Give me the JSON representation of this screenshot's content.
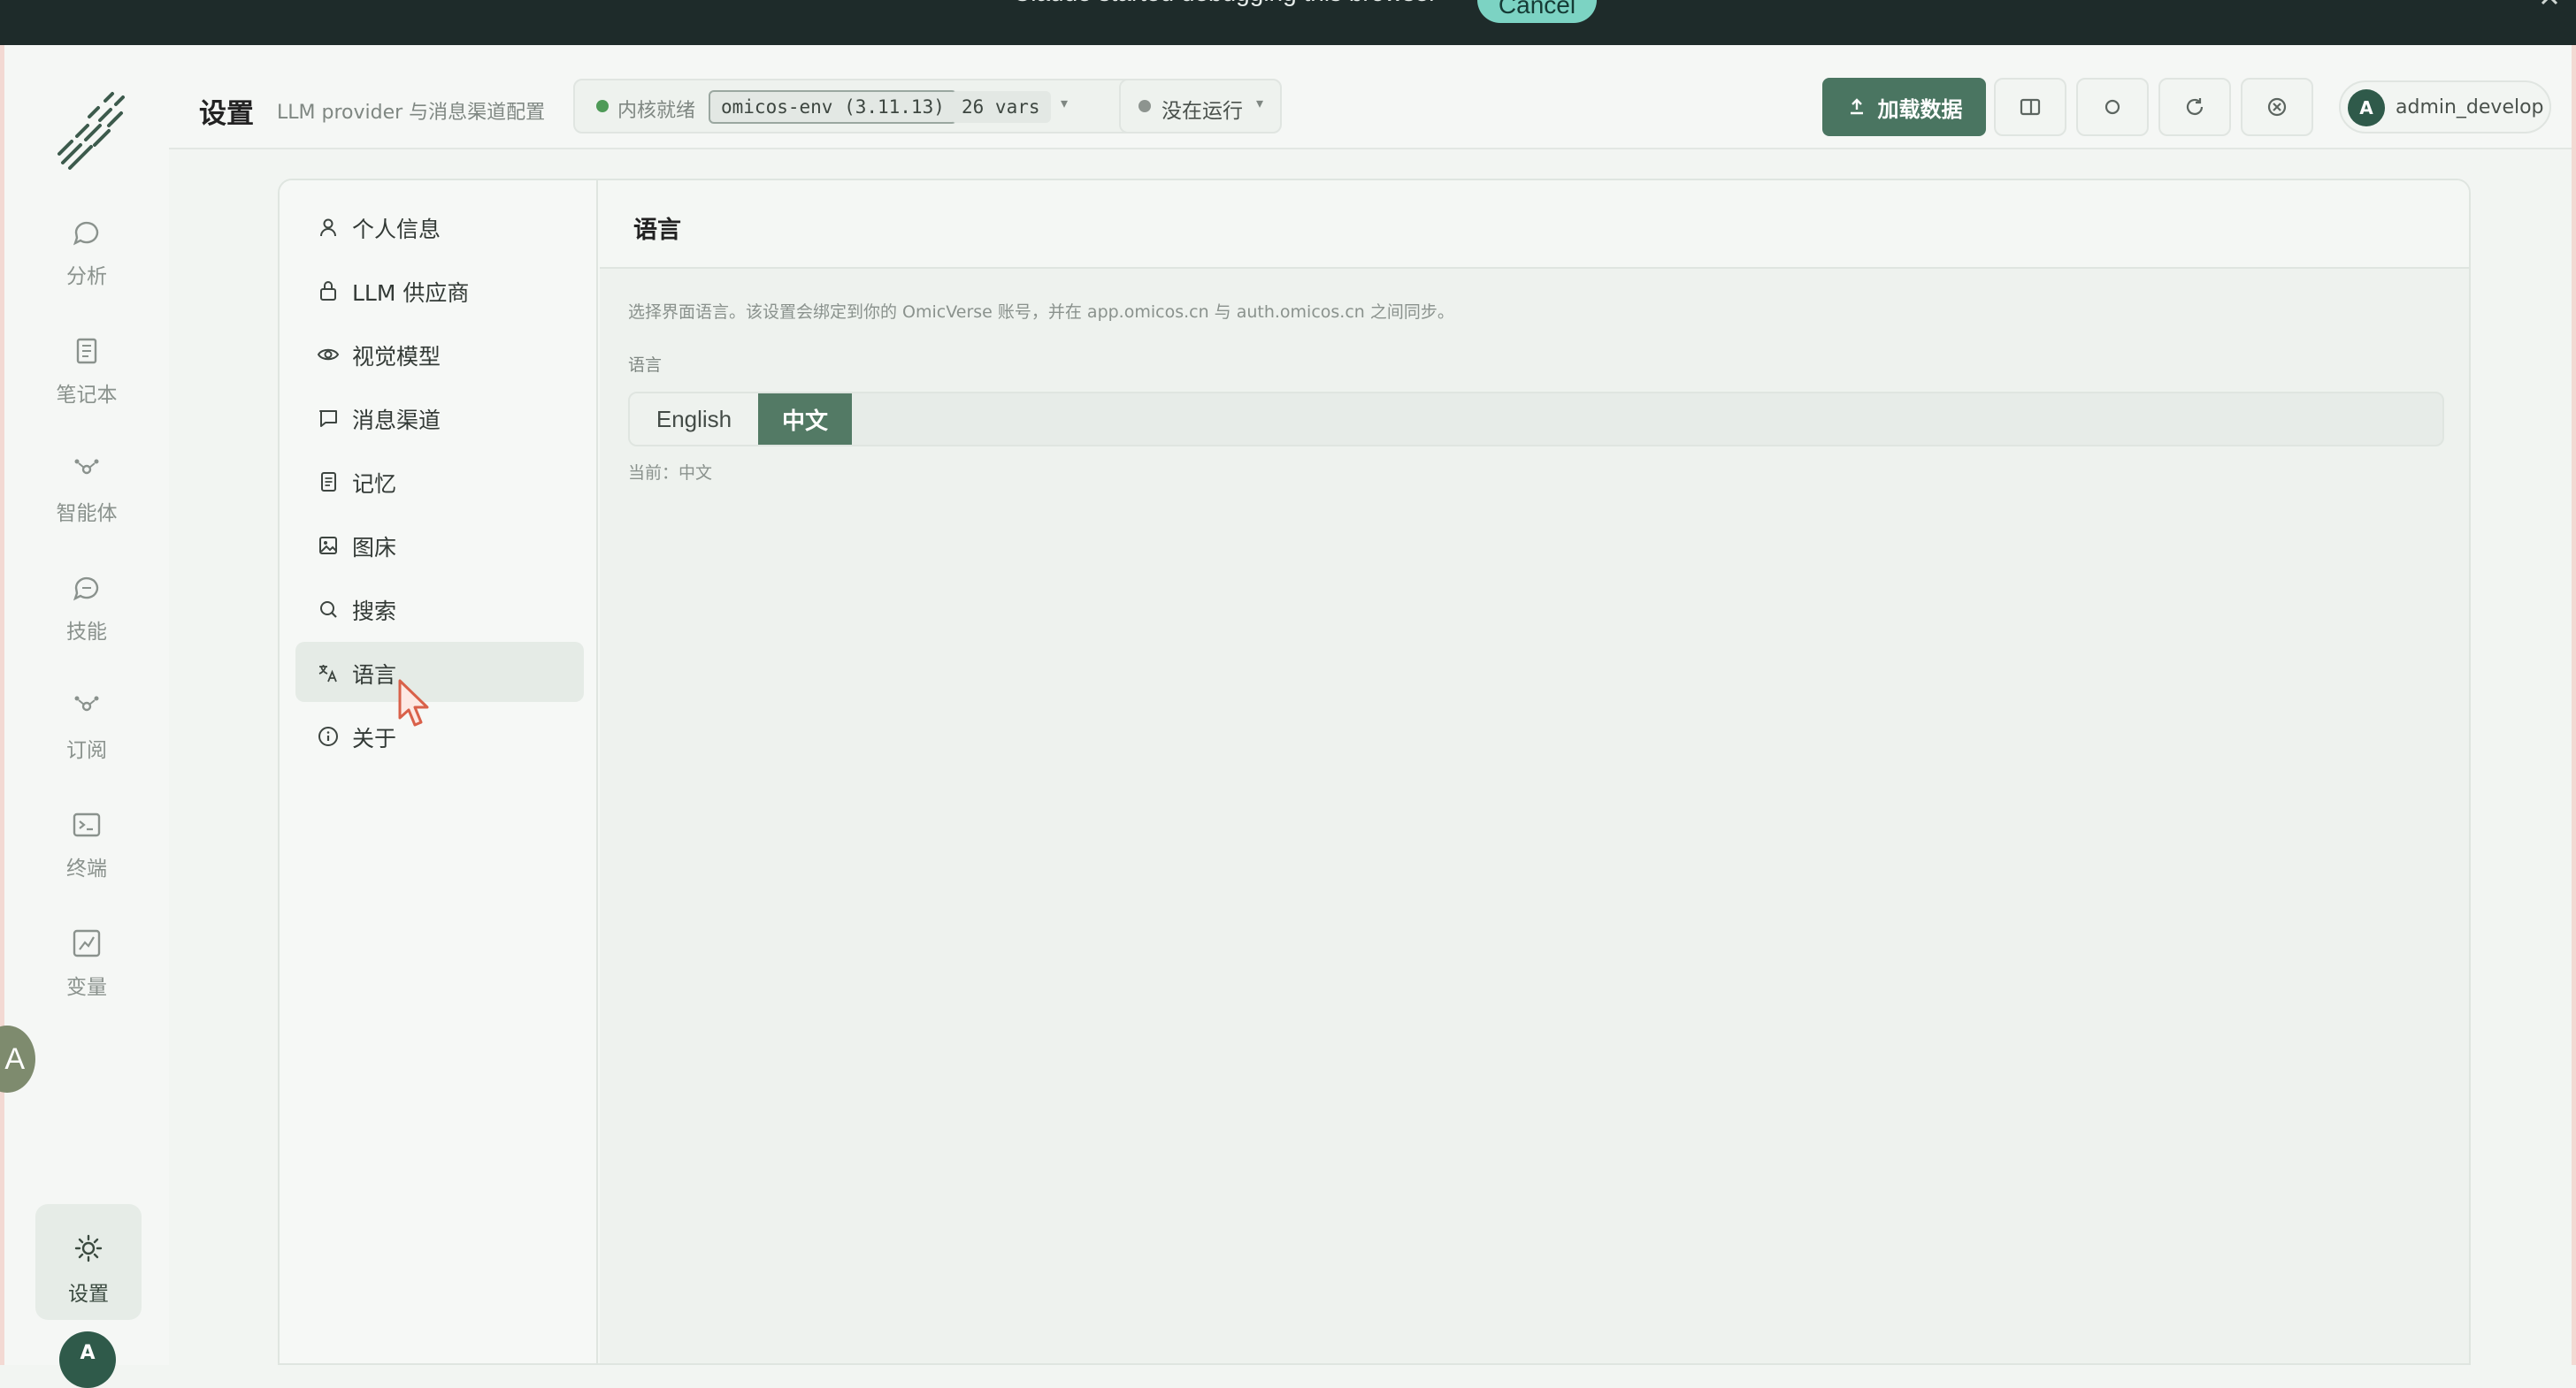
{
  "banner": {
    "text": "Claude  started debugging this browser",
    "cancel_label": "Cancel"
  },
  "rail": {
    "items": [
      {
        "label": "分析",
        "icon": "chat-bubble-icon"
      },
      {
        "label": "笔记本",
        "icon": "notebook-icon"
      },
      {
        "label": "智能体",
        "icon": "agent-nodes-icon"
      },
      {
        "label": "技能",
        "icon": "chat-bubble-icon"
      },
      {
        "label": "订阅",
        "icon": "agent-nodes-icon"
      },
      {
        "label": "终端",
        "icon": "terminal-icon"
      },
      {
        "label": "变量",
        "icon": "variables-icon"
      }
    ],
    "settings_label": "设置",
    "avatar_initial": "A",
    "float_badge_text": "A"
  },
  "header": {
    "title": "设置",
    "subtitle": "LLM provider 与消息渠道配置",
    "kernel_status": "内核就绪",
    "kernel_env": "omicos-env (3.11.13)",
    "kernel_vars": "26 vars",
    "run_status": "没在运行",
    "load_button": "加载数据",
    "user_initial": "A",
    "user_name": "admin_develop"
  },
  "settings_nav": {
    "items": [
      {
        "label": "个人信息",
        "icon": "user-icon"
      },
      {
        "label": "LLM 供应商",
        "icon": "lock-icon"
      },
      {
        "label": "视觉模型",
        "icon": "eye-icon"
      },
      {
        "label": "消息渠道",
        "icon": "message-icon"
      },
      {
        "label": "记忆",
        "icon": "document-icon"
      },
      {
        "label": "图床",
        "icon": "image-icon"
      },
      {
        "label": "搜索",
        "icon": "search-icon"
      },
      {
        "label": "语言",
        "icon": "translate-icon"
      },
      {
        "label": "关于",
        "icon": "info-icon"
      }
    ],
    "active_label": "语言"
  },
  "language_panel": {
    "title": "语言",
    "description": "选择界面语言。该设置会绑定到你的 OmicVerse 账号，并在 app.omicos.cn 与 auth.omicos.cn 之间同步。",
    "field_label": "语言",
    "options": [
      "English",
      "中文"
    ],
    "selected": "中文",
    "current_text": "当前：中文"
  },
  "colors": {
    "accent": "#537a65",
    "banner_bg": "#1e2b2a",
    "cancel_bg": "#7cd3c3",
    "status_ready": "#4e9a57"
  }
}
